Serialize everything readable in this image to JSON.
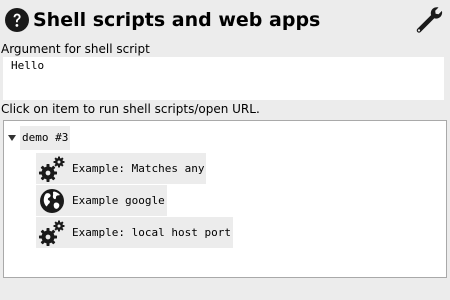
{
  "header": {
    "title": "Shell scripts and web apps",
    "help_icon": "question-circle-icon",
    "settings_icon": "wrench-icon"
  },
  "argument": {
    "label": "Argument for shell script",
    "value": "Hello"
  },
  "instruction": "Click on item to run shell scripts/open URL.",
  "tree": {
    "group": {
      "label": "demo #3",
      "expanded": true,
      "items": [
        {
          "label": "Example: Matches any",
          "icon": "gears-icon"
        },
        {
          "label": "Example google",
          "icon": "globe-icon"
        },
        {
          "label": "Example: local host port",
          "icon": "gears-icon"
        }
      ]
    }
  },
  "colors": {
    "background": "#ececec",
    "panel": "#ffffff",
    "item_highlight": "#ececec",
    "icon": "#1a1a1a"
  }
}
